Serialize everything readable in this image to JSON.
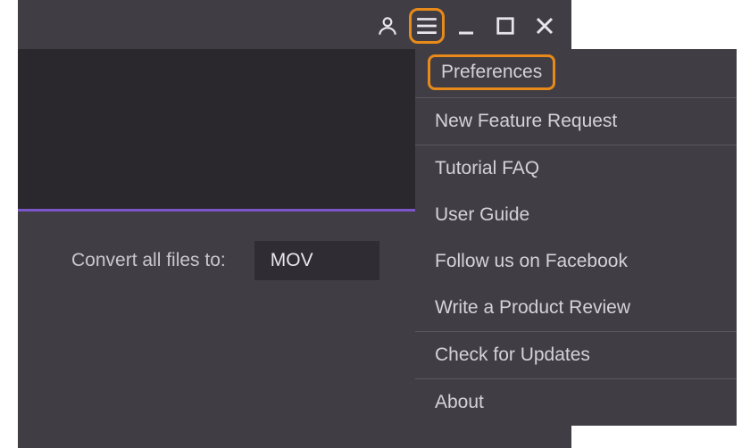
{
  "convert": {
    "label": "Convert all files to:",
    "selected_format": "MOV"
  },
  "menu": {
    "preferences": "Preferences",
    "new_feature_request": "New Feature Request",
    "tutorial_faq": "Tutorial FAQ",
    "user_guide": "User Guide",
    "follow_facebook": "Follow us on Facebook",
    "write_review": "Write a Product Review",
    "check_updates": "Check for Updates",
    "about": "About"
  }
}
